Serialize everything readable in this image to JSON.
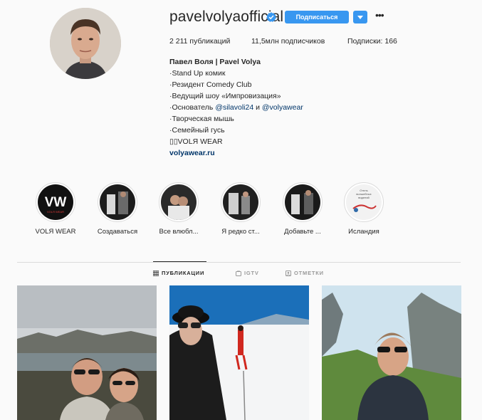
{
  "profile": {
    "username": "pavelvolyaofficial",
    "follow_label": "Подписаться",
    "stats": {
      "posts": "2 211 публикаций",
      "followers": "11,5млн подписчиков",
      "following": "Подписки: 166"
    },
    "bio": {
      "name": "Павел Воля | Pavel Volya",
      "lines": [
        "·Stand Up комик",
        "·Резидент Comedy Club",
        "·Ведущий шоу «Импровизация»"
      ],
      "founder_prefix": "·Основатель ",
      "founder_mention_1": "@silavoli24",
      "founder_and": " и ",
      "founder_mention_2": "@volyawear",
      "lines_after": [
        "·Творческая мышь",
        "·Семейный гусь",
        "▯▯VOLЯ WEAR"
      ],
      "link": "volyawear.ru"
    }
  },
  "highlights": [
    {
      "label": "VOLЯ WEAR",
      "logo_text": "VW",
      "logo_sub": "VOLЯ WEAR"
    },
    {
      "label": "Создаваться"
    },
    {
      "label": "Все влюбл..."
    },
    {
      "label": "Я редко ст..."
    },
    {
      "label": "Добавьте ..."
    },
    {
      "label": "Исландия",
      "caption": "Отель\nволшебных\nвидений"
    }
  ],
  "tabs": [
    {
      "label": "ПУБЛИКАЦИИ",
      "icon": "grid-icon",
      "active": true
    },
    {
      "label": "IGTV",
      "icon": "tv-icon",
      "active": false
    },
    {
      "label": "ОТМЕТКИ",
      "icon": "tag-icon",
      "active": false
    }
  ],
  "colors": {
    "accent": "#3897f0",
    "link": "#003569",
    "background": "#fafafa",
    "border": "#dbdbdb"
  }
}
